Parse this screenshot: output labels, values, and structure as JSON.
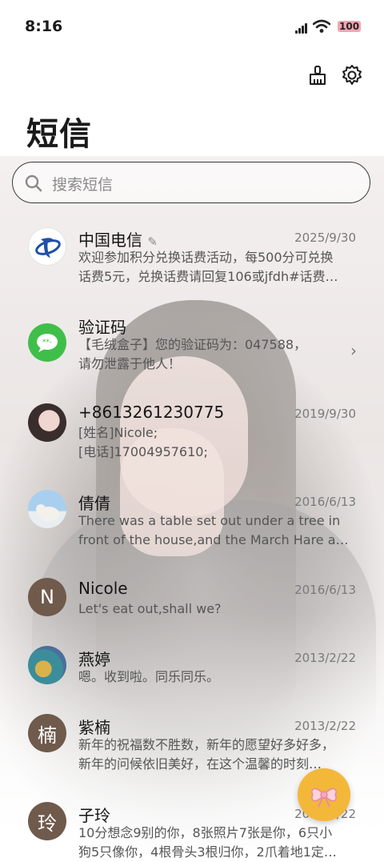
{
  "status_bar": {
    "time": "8:16",
    "battery": "100"
  },
  "toolbar": {
    "clean_icon": "broom-icon",
    "settings_icon": "gear-icon"
  },
  "header": {
    "title": "短信"
  },
  "search": {
    "placeholder": "搜索短信"
  },
  "conversations": [
    {
      "name": "中国电信",
      "date": "2025/9/30",
      "lines": [
        "欢迎参加积分兑换话费活动，每500分可兑换",
        "话费5元，兑换话费请回复106或jfdh#话费…"
      ],
      "avatar": "china-telecom-logo"
    },
    {
      "name": "验证码",
      "date": "",
      "lines": [
        "【毛绒盒子】您的验证码为：047588，",
        "请勿泄露于他人！"
      ],
      "avatar": "message-bubble-icon"
    },
    {
      "name": "+8613261230775",
      "date": "2019/9/30",
      "lines": [
        "[姓名]Nicole;",
        "[电话]17004957610;"
      ],
      "avatar": "photo"
    },
    {
      "name": "倩倩",
      "date": "2016/6/13",
      "lines": [
        "There was a table set out under a tree in",
        "front of the house,and the March Hare an…"
      ],
      "avatar": "polar-bear-photo"
    },
    {
      "name": "Nicole",
      "date": "2016/6/13",
      "lines": [
        "Let's eat out,shall we?"
      ],
      "avatar": "N"
    },
    {
      "name": "燕婷",
      "date": "2013/2/22",
      "lines": [
        "嗯。收到啦。同乐同乐。"
      ],
      "avatar": "painting-photo"
    },
    {
      "name": "紫楠",
      "date": "2013/2/22",
      "lines": [
        "新年的祝福数不胜数，新年的愿望好多好多，",
        "新年的问候依旧美好，在这个温馨的时刻…"
      ],
      "avatar": "楠"
    },
    {
      "name": "子玲",
      "date": "2013/2/22",
      "lines": [
        "10分想念9别的你，8张照片7张是你，6只小",
        "狗5只像你，4根骨头3根归你，2爪着地1定…"
      ],
      "avatar": "玲"
    }
  ],
  "fab": {
    "icon": "gift-bow-icon"
  },
  "colors": {
    "accent": "#f3b73a",
    "telecom_blue": "#1f4fa8",
    "message_green": "#3fbf4a"
  }
}
